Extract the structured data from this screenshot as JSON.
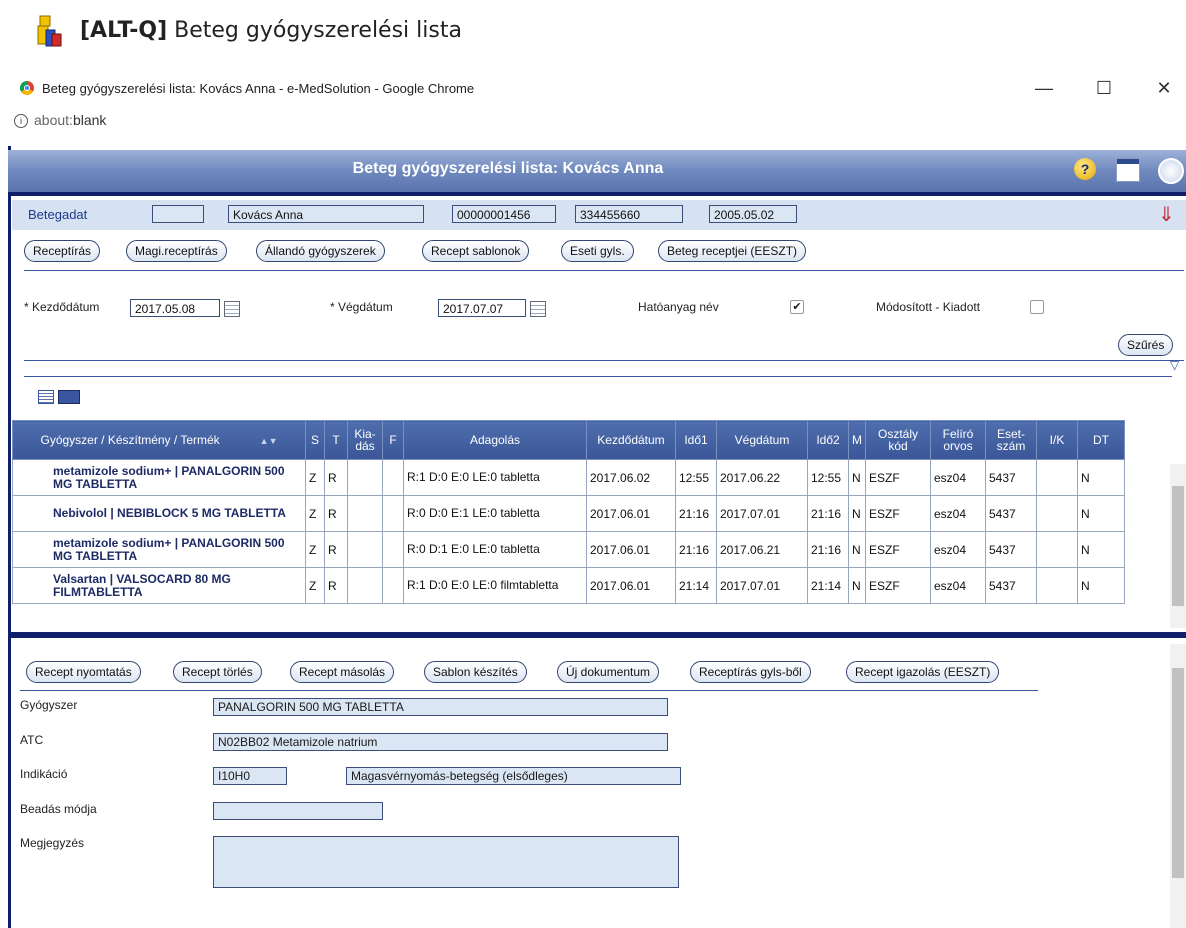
{
  "app": {
    "shortcut": "[ALT-Q]",
    "title": "Beteg gyógyszerelési lista"
  },
  "browser": {
    "window_title": "Beteg gyógyszerelési lista: Kovács Anna - e-MedSolution - Google Chrome",
    "address_prefix": "about:",
    "address_rest": "blank",
    "minimize": "—",
    "maximize": "☐",
    "close": "✕"
  },
  "window": {
    "title": "Beteg gyógyszerelési lista: Kovács Anna",
    "help_glyph": "?"
  },
  "patient": {
    "label": "Betegadat",
    "field0": "",
    "name": "Kovács Anna",
    "id1": "00000001456",
    "id2": "334455660",
    "date": "2005.05.02",
    "arrow_glyph": "⇓"
  },
  "top_buttons": [
    "Receptírás",
    "Magi.receptírás",
    "Állandó gyógyszerek",
    "Recept sablonok",
    "Eseti gyls.",
    "Beteg receptjei (EESZT)"
  ],
  "filter": {
    "start_label": "* Kezdődátum",
    "start_value": "2017.05.08",
    "end_label": "* Végdátum",
    "end_value": "2017.07.07",
    "substance_label": "Hatóanyag név",
    "substance_checked": "✔",
    "modified_label": "Módosított - Kiadott",
    "modified_checked": "",
    "filter_button": "Szűrés",
    "collapse_glyph": "▽"
  },
  "table": {
    "headers": [
      "Gyógyszer / Készítmény / Termék",
      "S",
      "T",
      "Kia-\ndás",
      "F",
      "Adagolás",
      "Kezdődátum",
      "Idő1",
      "Végdátum",
      "Idő2",
      "M",
      "Osztály\nkód",
      "Felíró\norvos",
      "Eset-\nszám",
      "I/K",
      "DT"
    ],
    "rows": [
      [
        "metamizole sodium+ | PANALGORIN 500 MG TABLETTA",
        "Z",
        "R",
        "",
        "",
        "R:1 D:0 E:0 LE:0 tabletta",
        "2017.06.02",
        "12:55",
        "2017.06.22",
        "12:55",
        "N",
        "ESZF",
        "esz04",
        "5437",
        "",
        "N"
      ],
      [
        "Nebivolol | NEBIBLOCK 5 MG TABLETTA",
        "Z",
        "R",
        "",
        "",
        "R:0 D:0 E:1 LE:0 tabletta",
        "2017.06.01",
        "21:16",
        "2017.07.01",
        "21:16",
        "N",
        "ESZF",
        "esz04",
        "5437",
        "",
        "N"
      ],
      [
        "metamizole sodium+ | PANALGORIN 500 MG TABLETTA",
        "Z",
        "R",
        "",
        "",
        "R:0 D:1 E:0 LE:0 tabletta",
        "2017.06.01",
        "21:16",
        "2017.06.21",
        "21:16",
        "N",
        "ESZF",
        "esz04",
        "5437",
        "",
        "N"
      ],
      [
        "Valsartan | VALSOCARD 80 MG FILMTABLETTA",
        "Z",
        "R",
        "",
        "",
        "R:1 D:0 E:0 LE:0 filmtabletta",
        "2017.06.01",
        "21:14",
        "2017.07.01",
        "21:14",
        "N",
        "ESZF",
        "esz04",
        "5437",
        "",
        "N"
      ]
    ]
  },
  "bottom_buttons": [
    "Recept nyomtatás",
    "Recept törlés",
    "Recept másolás",
    "Sablon készítés",
    "Új dokumentum",
    "Receptírás gyls-ből",
    "Recept igazolás (EESZT)"
  ],
  "details": {
    "drug_label": "Gyógyszer",
    "drug_value": "PANALGORIN 500 MG TABLETTA",
    "atc_label": "ATC",
    "atc_value": "N02BB02 Metamizole natrium",
    "indication_label": "Indikáció",
    "indication_code": "I10H0",
    "indication_text": "Magasvérnyomás-betegség (elsődleges)",
    "route_label": "Beadás módja",
    "route_value": "",
    "note_label": "Megjegyzés",
    "note_value": ""
  },
  "colors": {
    "titlebar": "#6f88be",
    "frame": "#0f1f6a",
    "header": "#3f5b9c",
    "field_bg": "#dbe6f4"
  }
}
